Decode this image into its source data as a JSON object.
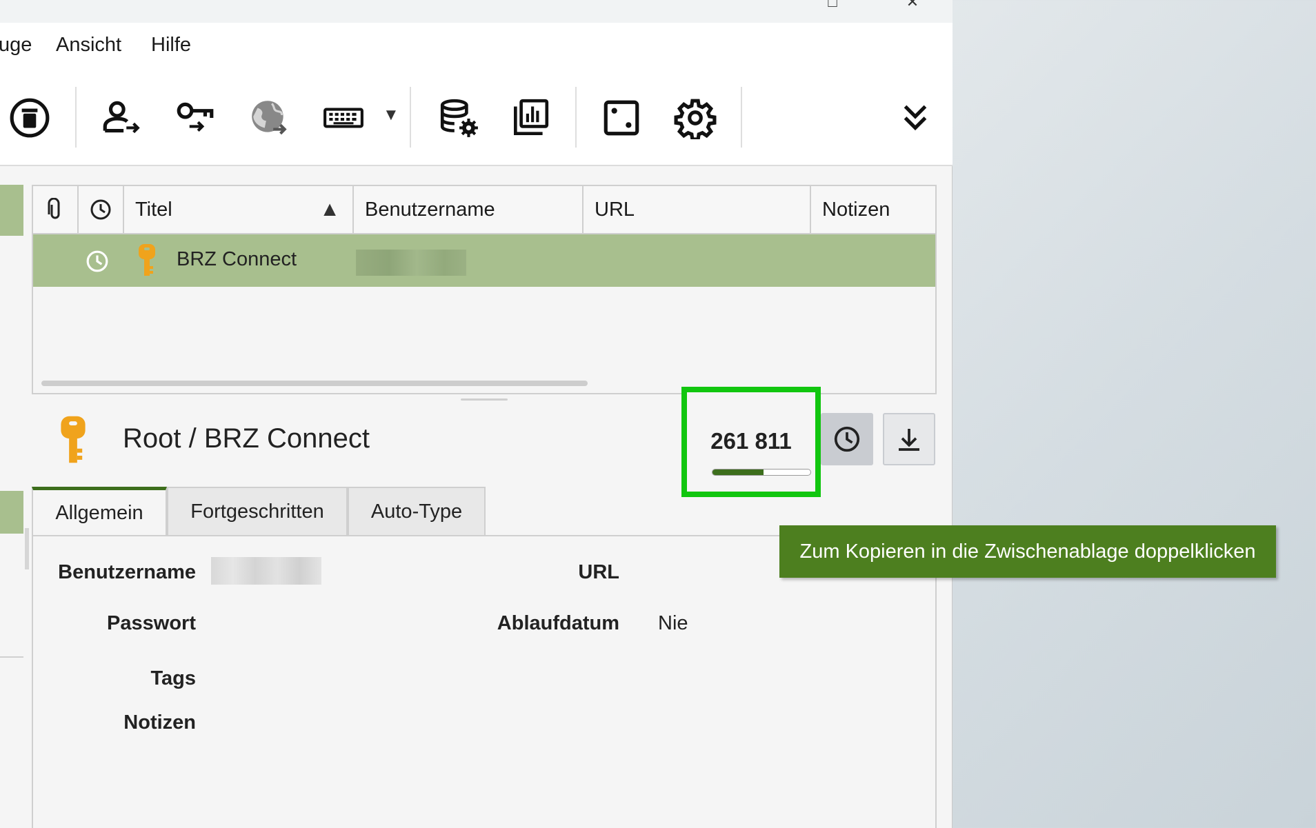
{
  "window": {
    "maximize_glyph": "□",
    "close_glyph": "✕"
  },
  "menu": {
    "items": [
      "uge",
      "Ansicht",
      "Hilfe"
    ]
  },
  "toolbar": {
    "buttons": [
      "delete-entry",
      "user-transfer",
      "key-transfer",
      "globe-transfer",
      "keyboard-autotype",
      "database-settings",
      "reports",
      "password-generator",
      "settings",
      "overflow"
    ],
    "dropdown_glyph": "▼"
  },
  "table": {
    "columns": [
      "Titel",
      "Benutzername",
      "URL",
      "Notizen"
    ],
    "sort_glyph": "▲",
    "rows": [
      {
        "title": "BRZ Connect",
        "username": "",
        "url": "",
        "notes": ""
      }
    ]
  },
  "detail": {
    "title": "Root / BRZ Connect",
    "totp": {
      "code": "261 811",
      "progress": 0.52
    },
    "tabs": [
      "Allgemein",
      "Fortgeschritten",
      "Auto-Type"
    ],
    "active_tab": "Allgemein",
    "fields": {
      "username_label": "Benutzername",
      "password_label": "Passwort",
      "tags_label": "Tags",
      "notes_label": "Notizen",
      "url_label": "URL",
      "expiry_label": "Ablaufdatum",
      "expiry_value": "Nie"
    }
  },
  "tooltip": "Zum Kopieren in die Zwischenablage doppelklicken",
  "colors": {
    "accent": "#3d6e1c",
    "selection": "#a8bf8e",
    "highlight_box": "#11c60f",
    "tooltip_bg": "#4d7f1f",
    "key_icon": "#f0a31c"
  }
}
